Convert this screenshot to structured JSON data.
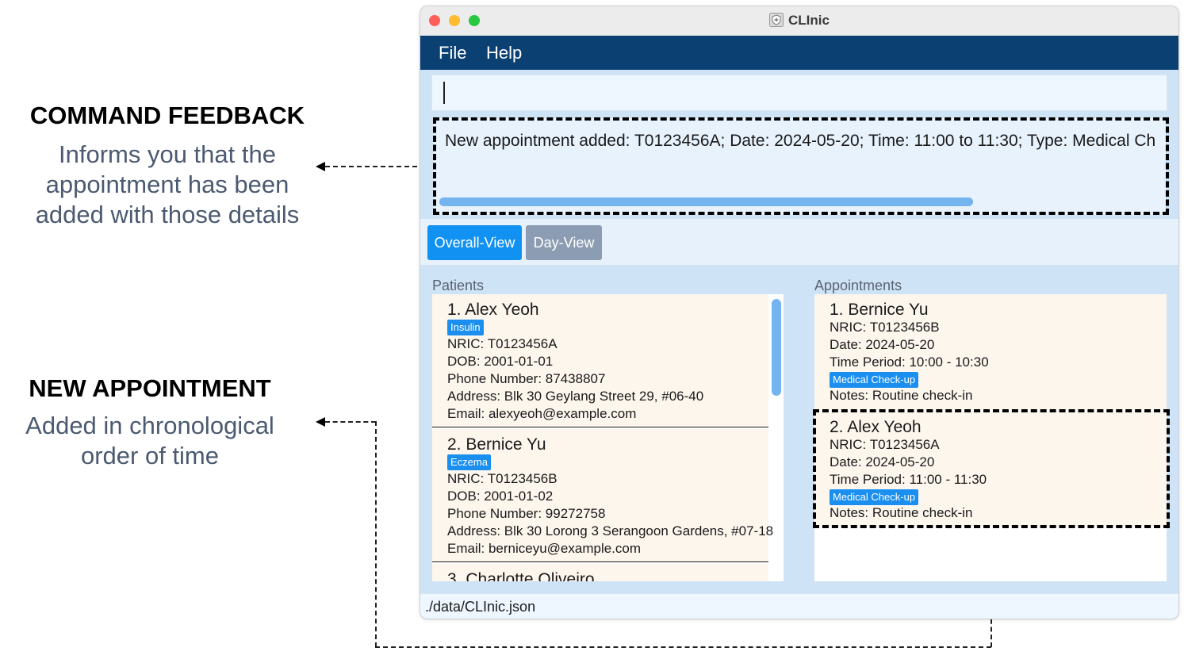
{
  "annotations": {
    "feedback": {
      "title": "COMMAND FEEDBACK",
      "desc_lines": [
        "Informs you that the",
        "appointment has been",
        "added with those details"
      ]
    },
    "new_appt": {
      "title": "NEW APPOINTMENT",
      "desc_lines": [
        "Added in chronological",
        "order of time"
      ]
    }
  },
  "window": {
    "title": "CLInic",
    "menu": [
      "File",
      "Help"
    ],
    "command_input": {
      "value": ""
    },
    "result_text": "New appointment added: T0123456A; Date: 2024-05-20; Time: 11:00 to 11:30; Type: Medical Ch",
    "tabs": [
      "Overall-View",
      "Day-View"
    ],
    "patients_label": "Patients",
    "appointments_label": "Appointments",
    "patients": [
      {
        "name": "1.  Alex Yeoh",
        "tag": "Insulin",
        "nric": "NRIC: T0123456A",
        "dob": "DOB: 2001-01-01",
        "phone": "Phone Number: 87438807",
        "address": "Address: Blk 30 Geylang Street 29, #06-40",
        "email": "Email: alexyeoh@example.com"
      },
      {
        "name": "2.  Bernice Yu",
        "tag": "Eczema",
        "nric": "NRIC: T0123456B",
        "dob": "DOB: 2001-01-02",
        "phone": "Phone Number: 99272758",
        "address": "Address: Blk 30 Lorong 3 Serangoon Gardens, #07-18",
        "email": "Email: berniceyu@example.com"
      },
      {
        "name": "3.  Charlotte Oliveiro"
      }
    ],
    "appointments": [
      {
        "name": "1.  Bernice Yu",
        "nric": "NRIC: T0123456B",
        "date": "Date: 2024-05-20",
        "time": "Time Period: 10:00 - 10:30",
        "type": "Medical Check-up",
        "notes": "Notes: Routine check-in"
      },
      {
        "name": "2.  Alex Yeoh",
        "nric": "NRIC: T0123456A",
        "date": "Date: 2024-05-20",
        "time": "Time Period: 11:00 - 11:30",
        "type": "Medical Check-up",
        "notes": "Notes: Routine check-in"
      }
    ],
    "status_path": "./data/CLInic.json"
  },
  "colors": {
    "menubar": "#0b4073",
    "accent": "#1191f1",
    "tag": "#1a8ff0",
    "card_bg": "#fdf6ed"
  }
}
